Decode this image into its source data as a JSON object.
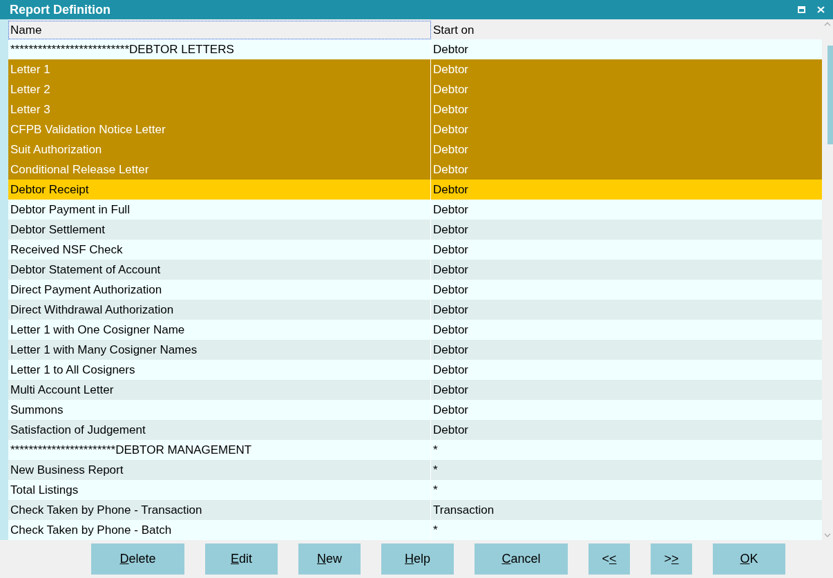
{
  "window": {
    "title": "Report Definition"
  },
  "table": {
    "columns": [
      "Name",
      "Start on"
    ],
    "rows": [
      {
        "name": "**************************DEBTOR LETTERS",
        "start_on": "Debtor",
        "selected": false,
        "focused": false
      },
      {
        "name": "Letter 1",
        "start_on": "Debtor",
        "selected": true,
        "focused": false
      },
      {
        "name": "Letter 2",
        "start_on": "Debtor",
        "selected": true,
        "focused": false
      },
      {
        "name": "Letter 3",
        "start_on": "Debtor",
        "selected": true,
        "focused": false
      },
      {
        "name": "CFPB Validation Notice Letter",
        "start_on": "Debtor",
        "selected": true,
        "focused": false
      },
      {
        "name": "Suit Authorization",
        "start_on": "Debtor",
        "selected": true,
        "focused": false
      },
      {
        "name": "Conditional Release Letter",
        "start_on": "Debtor",
        "selected": true,
        "focused": false
      },
      {
        "name": "Debtor Receipt",
        "start_on": "Debtor",
        "selected": false,
        "focused": true
      },
      {
        "name": "Debtor Payment in Full",
        "start_on": "Debtor",
        "selected": false,
        "focused": false
      },
      {
        "name": "Debtor Settlement",
        "start_on": "Debtor",
        "selected": false,
        "focused": false
      },
      {
        "name": "Received NSF Check",
        "start_on": "Debtor",
        "selected": false,
        "focused": false
      },
      {
        "name": "Debtor Statement of Account",
        "start_on": "Debtor",
        "selected": false,
        "focused": false
      },
      {
        "name": "Direct Payment Authorization",
        "start_on": "Debtor",
        "selected": false,
        "focused": false
      },
      {
        "name": "Direct Withdrawal Authorization",
        "start_on": "Debtor",
        "selected": false,
        "focused": false
      },
      {
        "name": "Letter 1 with One Cosigner Name",
        "start_on": "Debtor",
        "selected": false,
        "focused": false
      },
      {
        "name": "Letter 1 with Many Cosigner Names",
        "start_on": "Debtor",
        "selected": false,
        "focused": false
      },
      {
        "name": "Letter 1 to All Cosigners",
        "start_on": "Debtor",
        "selected": false,
        "focused": false
      },
      {
        "name": "Multi Account Letter",
        "start_on": "Debtor",
        "selected": false,
        "focused": false
      },
      {
        "name": "Summons",
        "start_on": "Debtor",
        "selected": false,
        "focused": false
      },
      {
        "name": "Satisfaction of Judgement",
        "start_on": "Debtor",
        "selected": false,
        "focused": false
      },
      {
        "name": "***********************DEBTOR MANAGEMENT",
        "start_on": "*",
        "selected": false,
        "focused": false
      },
      {
        "name": "New Business Report",
        "start_on": "*",
        "selected": false,
        "focused": false
      },
      {
        "name": "Total Listings",
        "start_on": "*",
        "selected": false,
        "focused": false
      },
      {
        "name": "Check Taken by Phone - Transaction",
        "start_on": "Transaction",
        "selected": false,
        "focused": false
      },
      {
        "name": "Check Taken by Phone - Batch",
        "start_on": "*",
        "selected": false,
        "focused": false
      }
    ]
  },
  "buttons": [
    {
      "key": "D",
      "post": "elete"
    },
    {
      "key": "E",
      "post": "dit"
    },
    {
      "key": "N",
      "post": "ew"
    },
    {
      "key": "H",
      "post": "elp"
    },
    {
      "key": "C",
      "post": "ancel"
    },
    {
      "pre": "<",
      "key": "<"
    },
    {
      "pre": ">",
      "key": ">"
    },
    {
      "key": "O",
      "post": "K"
    }
  ]
}
